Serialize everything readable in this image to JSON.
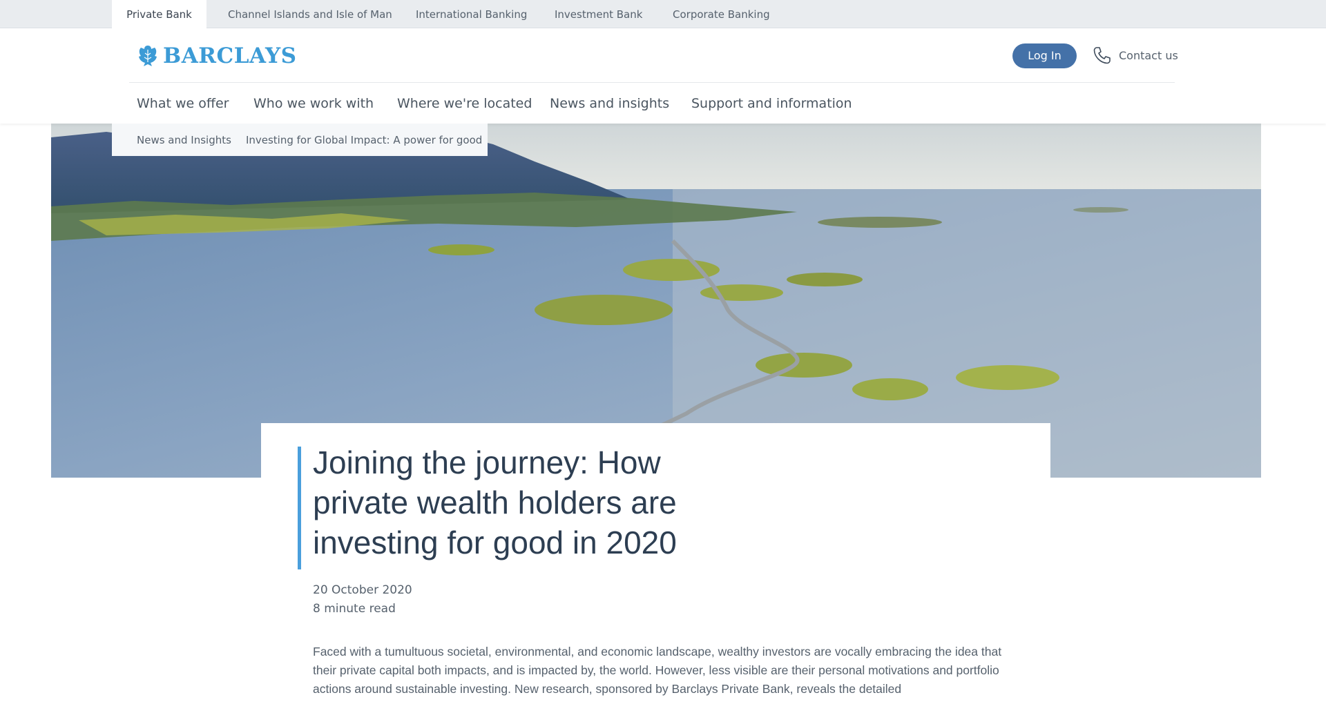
{
  "segment_tabs": [
    {
      "label": "Private Bank",
      "active": true
    },
    {
      "label": "Channel Islands and Isle of Man",
      "active": false
    },
    {
      "label": "International Banking",
      "active": false
    },
    {
      "label": "Investment Bank",
      "active": false
    },
    {
      "label": "Corporate Banking",
      "active": false
    }
  ],
  "header": {
    "brand": "BARCLAYS",
    "login_label": "Log In",
    "contact_label": "Contact us"
  },
  "main_nav": [
    {
      "label": "What we offer"
    },
    {
      "label": "Who we work with"
    },
    {
      "label": "Where we're located"
    },
    {
      "label": "News and insights"
    },
    {
      "label": "Support and information"
    }
  ],
  "breadcrumb": {
    "parent": "News and Insights",
    "current": "Investing for Global Impact: A power for good"
  },
  "article": {
    "title": "Joining the journey: How private wealth holders are investing for good in 2020",
    "date": "20 October 2020",
    "read_time": "8 minute read",
    "intro": "Faced with a tumultuous societal, environmental, and economic landscape, wealthy investors are vocally embracing the idea that their private capital both impacts, and is impacted by, the world. However, less visible are their personal motivations and portfolio actions around sustainable investing.  New research, sponsored by Barclays Private Bank, reveals the detailed"
  },
  "colors": {
    "brand_blue": "#3c9bd6",
    "login_bg": "#4471a8",
    "title_accent": "#4a9fdc",
    "title_text": "#2d3e52",
    "body_text": "#56616d"
  },
  "icons": {
    "logo": "eagle-icon",
    "contact": "phone-icon"
  }
}
